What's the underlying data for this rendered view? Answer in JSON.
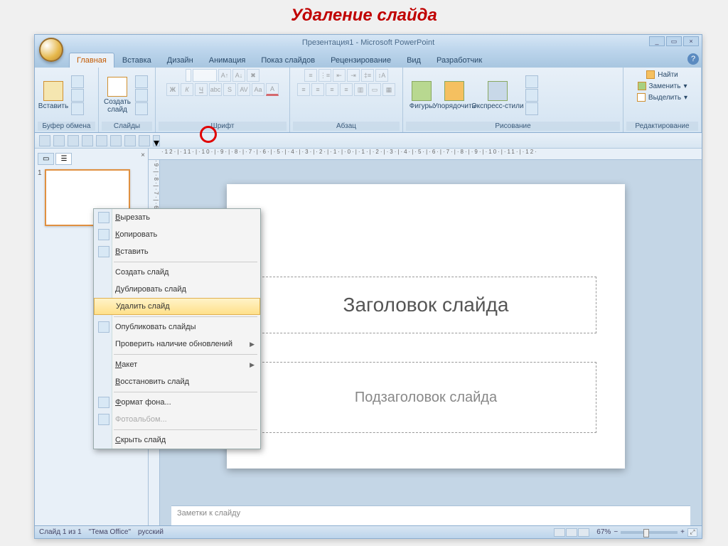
{
  "page_heading": "Удаление слайда",
  "window": {
    "title": "Презентация1 - Microsoft PowerPoint",
    "min": "_",
    "max": "▭",
    "close": "×"
  },
  "tabs": [
    "Главная",
    "Вставка",
    "Дизайн",
    "Анимация",
    "Показ слайдов",
    "Рецензирование",
    "Вид",
    "Разработчик"
  ],
  "active_tab_index": 0,
  "ribbon": {
    "clipboard": {
      "label": "Буфер обмена",
      "paste": "Вставить"
    },
    "slides": {
      "label": "Слайды",
      "new_slide": "Создать\nслайд"
    },
    "font": {
      "label": "Шрифт"
    },
    "paragraph": {
      "label": "Абзац"
    },
    "drawing": {
      "label": "Рисование",
      "shapes": "Фигуры",
      "arrange": "Упорядочить",
      "styles": "Экспресс-стили"
    },
    "editing": {
      "label": "Редактирование",
      "find": "Найти",
      "replace": "Заменить",
      "select": "Выделить"
    }
  },
  "panel_tabs": {
    "outline": "☰",
    "slides": "▭"
  },
  "thumb_number": "1",
  "context_menu": [
    {
      "label": "Вырезать",
      "icon": true,
      "hotkey": "В"
    },
    {
      "label": "Копировать",
      "icon": true,
      "hotkey": "К"
    },
    {
      "label": "Вставить",
      "icon": true,
      "hotkey": "В"
    },
    {
      "sep": true
    },
    {
      "label": "Создать слайд",
      "hotkey": "д"
    },
    {
      "label": "Дублировать слайд"
    },
    {
      "label": "Удалить слайд",
      "highlight": true
    },
    {
      "sep": true
    },
    {
      "label": "Опубликовать слайды",
      "icon": true
    },
    {
      "label": "Проверить наличие обновлений",
      "arrow": true
    },
    {
      "sep": true
    },
    {
      "label": "Макет",
      "arrow": true,
      "hotkey": "М"
    },
    {
      "label": "Восстановить слайд",
      "hotkey": "В"
    },
    {
      "sep": true
    },
    {
      "label": "Формат фона...",
      "icon": true,
      "hotkey": "Ф"
    },
    {
      "label": "Фотоальбом...",
      "icon": true,
      "disabled": true
    },
    {
      "sep": true
    },
    {
      "label": "Скрыть слайд",
      "hotkey": "С"
    }
  ],
  "slide": {
    "title_placeholder": "Заголовок слайда",
    "subtitle_placeholder": "Подзаголовок слайда"
  },
  "ruler_h_text": "·12·|·11·|·10·|·9·|·8·|·7·|·6·|·5·|·4·|·3·|·2·|·1·|·0·|·1·|·2·|·3·|·4·|·5·|·6·|·7·|·8·|·9·|·10·|·11·|·12·",
  "ruler_v_text": "·9·|·8·|·7·|·6·|·5·|·4·|·3·|·2·|·1·|·0·|·1·|·2·|·3·|·4·|·5·|·6·|·7·|·8·|·9·",
  "notes": "Заметки к слайду",
  "status": {
    "slide_of": "Слайд 1 из 1",
    "theme": "\"Тема Office\"",
    "lang": "русский",
    "zoom": "67%"
  }
}
